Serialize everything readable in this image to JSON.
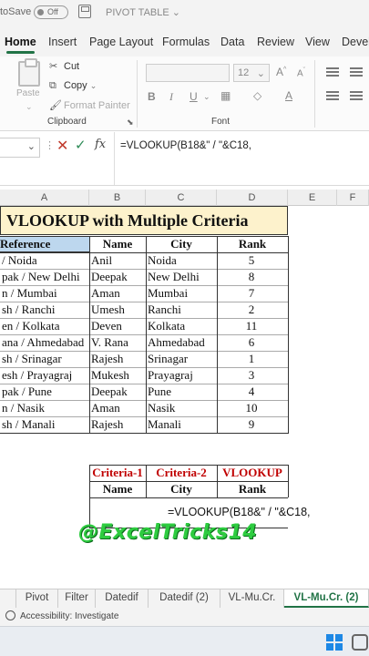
{
  "titlebar": {
    "autosave_label": "toSave",
    "autosave_state": "Off",
    "doc_title": "PIVOT TABLE ⌄"
  },
  "ribbon_tabs": [
    "Home",
    "Insert",
    "Page Layout",
    "Formulas",
    "Data",
    "Review",
    "View",
    "Devell"
  ],
  "clipboard": {
    "paste_label": "Paste",
    "cut_label": "Cut",
    "copy_label": "Copy",
    "format_painter_label": "Format Painter",
    "group_label": "Clipboard"
  },
  "font_group": {
    "size": "12",
    "group_label": "Font"
  },
  "formula_bar": {
    "fx_label": "fx",
    "formula": "=VLOOKUP(B18&\" / \"&C18,"
  },
  "columns": [
    "A",
    "B",
    "C",
    "D",
    "E",
    "F"
  ],
  "sheet": {
    "title": "VLOOKUP with Multiple Criteria",
    "headers": {
      "reference": "Reference",
      "name": "Name",
      "city": "City",
      "rank": "Rank"
    },
    "rows": [
      {
        "reference": "/ Noida",
        "name": "Anil",
        "city": "Noida",
        "rank": "5"
      },
      {
        "reference": "pak / New Delhi",
        "name": "Deepak",
        "city": "New Delhi",
        "rank": "8"
      },
      {
        "reference": "n / Mumbai",
        "name": "Aman",
        "city": "Mumbai",
        "rank": "7"
      },
      {
        "reference": "sh / Ranchi",
        "name": "Umesh",
        "city": "Ranchi",
        "rank": "2"
      },
      {
        "reference": "en / Kolkata",
        "name": "Deven",
        "city": "Kolkata",
        "rank": "11"
      },
      {
        "reference": "ana / Ahmedabad",
        "name": "V. Rana",
        "city": "Ahmedabad",
        "rank": "6"
      },
      {
        "reference": "sh / Srinagar",
        "name": "Rajesh",
        "city": "Srinagar",
        "rank": "1"
      },
      {
        "reference": "esh / Prayagraj",
        "name": "Mukesh",
        "city": "Prayagraj",
        "rank": "3"
      },
      {
        "reference": "pak / Pune",
        "name": "Deepak",
        "city": "Pune",
        "rank": "4"
      },
      {
        "reference": "n / Nasik",
        "name": "Aman",
        "city": "Nasik",
        "rank": "10"
      },
      {
        "reference": "sh / Manali",
        "name": "Rajesh",
        "city": "Manali",
        "rank": "9"
      }
    ],
    "lookup": {
      "criteria1": "Criteria-1",
      "criteria2": "Criteria-2",
      "vlookup": "VLOOKUP",
      "name": "Name",
      "city": "City",
      "rank": "Rank",
      "typed_formula": "=VLOOKUP(B18&\" / \"&C18,"
    },
    "watermark": "@ExcelTricks14"
  },
  "sheet_tabs": [
    "Pivot",
    "Filter",
    "Datedif",
    "Datedif (2)",
    "VL-Mu.Cr.",
    "VL-Mu.Cr. (2)"
  ],
  "active_sheet_tab": "VL-Mu.Cr. (2)",
  "status": {
    "accessibility": "Accessibility: Investigate"
  },
  "colors": {
    "accent": "#217346",
    "title_fill": "#fdf2cc",
    "ref_header_fill": "#bdd7ee",
    "criteria_red": "#c00000",
    "watermark_green": "#2ecc40"
  }
}
